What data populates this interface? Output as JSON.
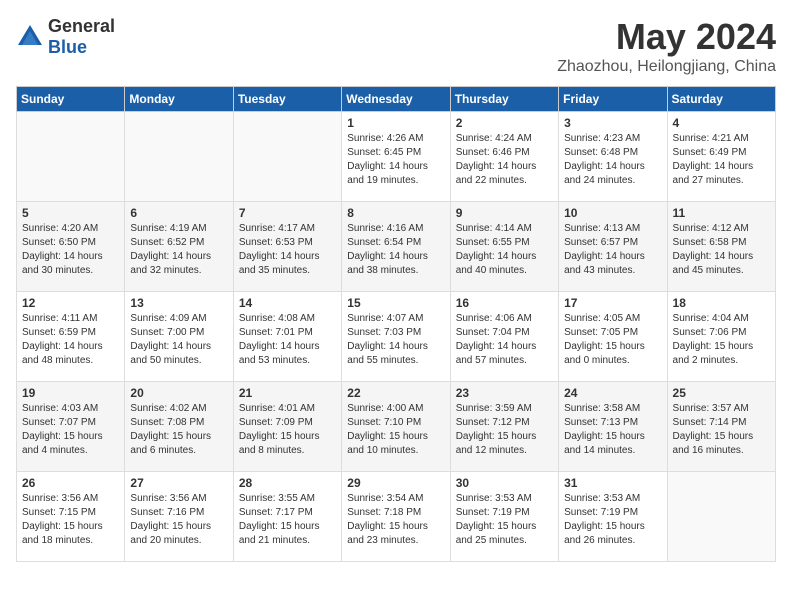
{
  "logo": {
    "general": "General",
    "blue": "Blue"
  },
  "title": {
    "month_year": "May 2024",
    "location": "Zhaozhou, Heilongjiang, China"
  },
  "days_of_week": [
    "Sunday",
    "Monday",
    "Tuesday",
    "Wednesday",
    "Thursday",
    "Friday",
    "Saturday"
  ],
  "weeks": [
    [
      {
        "day": "",
        "info": ""
      },
      {
        "day": "",
        "info": ""
      },
      {
        "day": "",
        "info": ""
      },
      {
        "day": "1",
        "info": "Sunrise: 4:26 AM\nSunset: 6:45 PM\nDaylight: 14 hours\nand 19 minutes."
      },
      {
        "day": "2",
        "info": "Sunrise: 4:24 AM\nSunset: 6:46 PM\nDaylight: 14 hours\nand 22 minutes."
      },
      {
        "day": "3",
        "info": "Sunrise: 4:23 AM\nSunset: 6:48 PM\nDaylight: 14 hours\nand 24 minutes."
      },
      {
        "day": "4",
        "info": "Sunrise: 4:21 AM\nSunset: 6:49 PM\nDaylight: 14 hours\nand 27 minutes."
      }
    ],
    [
      {
        "day": "5",
        "info": "Sunrise: 4:20 AM\nSunset: 6:50 PM\nDaylight: 14 hours\nand 30 minutes."
      },
      {
        "day": "6",
        "info": "Sunrise: 4:19 AM\nSunset: 6:52 PM\nDaylight: 14 hours\nand 32 minutes."
      },
      {
        "day": "7",
        "info": "Sunrise: 4:17 AM\nSunset: 6:53 PM\nDaylight: 14 hours\nand 35 minutes."
      },
      {
        "day": "8",
        "info": "Sunrise: 4:16 AM\nSunset: 6:54 PM\nDaylight: 14 hours\nand 38 minutes."
      },
      {
        "day": "9",
        "info": "Sunrise: 4:14 AM\nSunset: 6:55 PM\nDaylight: 14 hours\nand 40 minutes."
      },
      {
        "day": "10",
        "info": "Sunrise: 4:13 AM\nSunset: 6:57 PM\nDaylight: 14 hours\nand 43 minutes."
      },
      {
        "day": "11",
        "info": "Sunrise: 4:12 AM\nSunset: 6:58 PM\nDaylight: 14 hours\nand 45 minutes."
      }
    ],
    [
      {
        "day": "12",
        "info": "Sunrise: 4:11 AM\nSunset: 6:59 PM\nDaylight: 14 hours\nand 48 minutes."
      },
      {
        "day": "13",
        "info": "Sunrise: 4:09 AM\nSunset: 7:00 PM\nDaylight: 14 hours\nand 50 minutes."
      },
      {
        "day": "14",
        "info": "Sunrise: 4:08 AM\nSunset: 7:01 PM\nDaylight: 14 hours\nand 53 minutes."
      },
      {
        "day": "15",
        "info": "Sunrise: 4:07 AM\nSunset: 7:03 PM\nDaylight: 14 hours\nand 55 minutes."
      },
      {
        "day": "16",
        "info": "Sunrise: 4:06 AM\nSunset: 7:04 PM\nDaylight: 14 hours\nand 57 minutes."
      },
      {
        "day": "17",
        "info": "Sunrise: 4:05 AM\nSunset: 7:05 PM\nDaylight: 15 hours\nand 0 minutes."
      },
      {
        "day": "18",
        "info": "Sunrise: 4:04 AM\nSunset: 7:06 PM\nDaylight: 15 hours\nand 2 minutes."
      }
    ],
    [
      {
        "day": "19",
        "info": "Sunrise: 4:03 AM\nSunset: 7:07 PM\nDaylight: 15 hours\nand 4 minutes."
      },
      {
        "day": "20",
        "info": "Sunrise: 4:02 AM\nSunset: 7:08 PM\nDaylight: 15 hours\nand 6 minutes."
      },
      {
        "day": "21",
        "info": "Sunrise: 4:01 AM\nSunset: 7:09 PM\nDaylight: 15 hours\nand 8 minutes."
      },
      {
        "day": "22",
        "info": "Sunrise: 4:00 AM\nSunset: 7:10 PM\nDaylight: 15 hours\nand 10 minutes."
      },
      {
        "day": "23",
        "info": "Sunrise: 3:59 AM\nSunset: 7:12 PM\nDaylight: 15 hours\nand 12 minutes."
      },
      {
        "day": "24",
        "info": "Sunrise: 3:58 AM\nSunset: 7:13 PM\nDaylight: 15 hours\nand 14 minutes."
      },
      {
        "day": "25",
        "info": "Sunrise: 3:57 AM\nSunset: 7:14 PM\nDaylight: 15 hours\nand 16 minutes."
      }
    ],
    [
      {
        "day": "26",
        "info": "Sunrise: 3:56 AM\nSunset: 7:15 PM\nDaylight: 15 hours\nand 18 minutes."
      },
      {
        "day": "27",
        "info": "Sunrise: 3:56 AM\nSunset: 7:16 PM\nDaylight: 15 hours\nand 20 minutes."
      },
      {
        "day": "28",
        "info": "Sunrise: 3:55 AM\nSunset: 7:17 PM\nDaylight: 15 hours\nand 21 minutes."
      },
      {
        "day": "29",
        "info": "Sunrise: 3:54 AM\nSunset: 7:18 PM\nDaylight: 15 hours\nand 23 minutes."
      },
      {
        "day": "30",
        "info": "Sunrise: 3:53 AM\nSunset: 7:19 PM\nDaylight: 15 hours\nand 25 minutes."
      },
      {
        "day": "31",
        "info": "Sunrise: 3:53 AM\nSunset: 7:19 PM\nDaylight: 15 hours\nand 26 minutes."
      },
      {
        "day": "",
        "info": ""
      }
    ]
  ]
}
